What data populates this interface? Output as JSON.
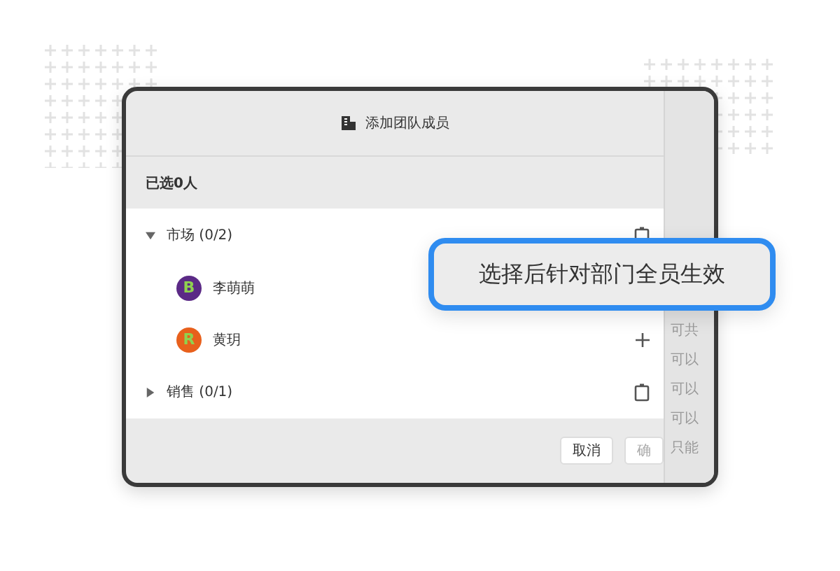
{
  "dialog": {
    "title": "添加团队成员",
    "selected_count": "已选0人",
    "groups": [
      {
        "name": "市场 (0/2)",
        "expanded": true,
        "members": [
          {
            "name": "李萌萌",
            "avatar": "B",
            "color": "#5b2a86"
          },
          {
            "name": "黄玥",
            "avatar": "R",
            "color": "#e8601c"
          }
        ]
      },
      {
        "name": "销售 (0/1)",
        "expanded": false
      }
    ],
    "buttons": [
      {
        "label": "取消",
        "disabled": false
      },
      {
        "label": "确",
        "disabled": true
      }
    ]
  },
  "side_panel": {
    "lines": [
      "可共",
      "可以",
      "可以",
      "可以",
      "只能"
    ]
  },
  "tooltip": {
    "text": "选择后针对部门全员生效"
  }
}
